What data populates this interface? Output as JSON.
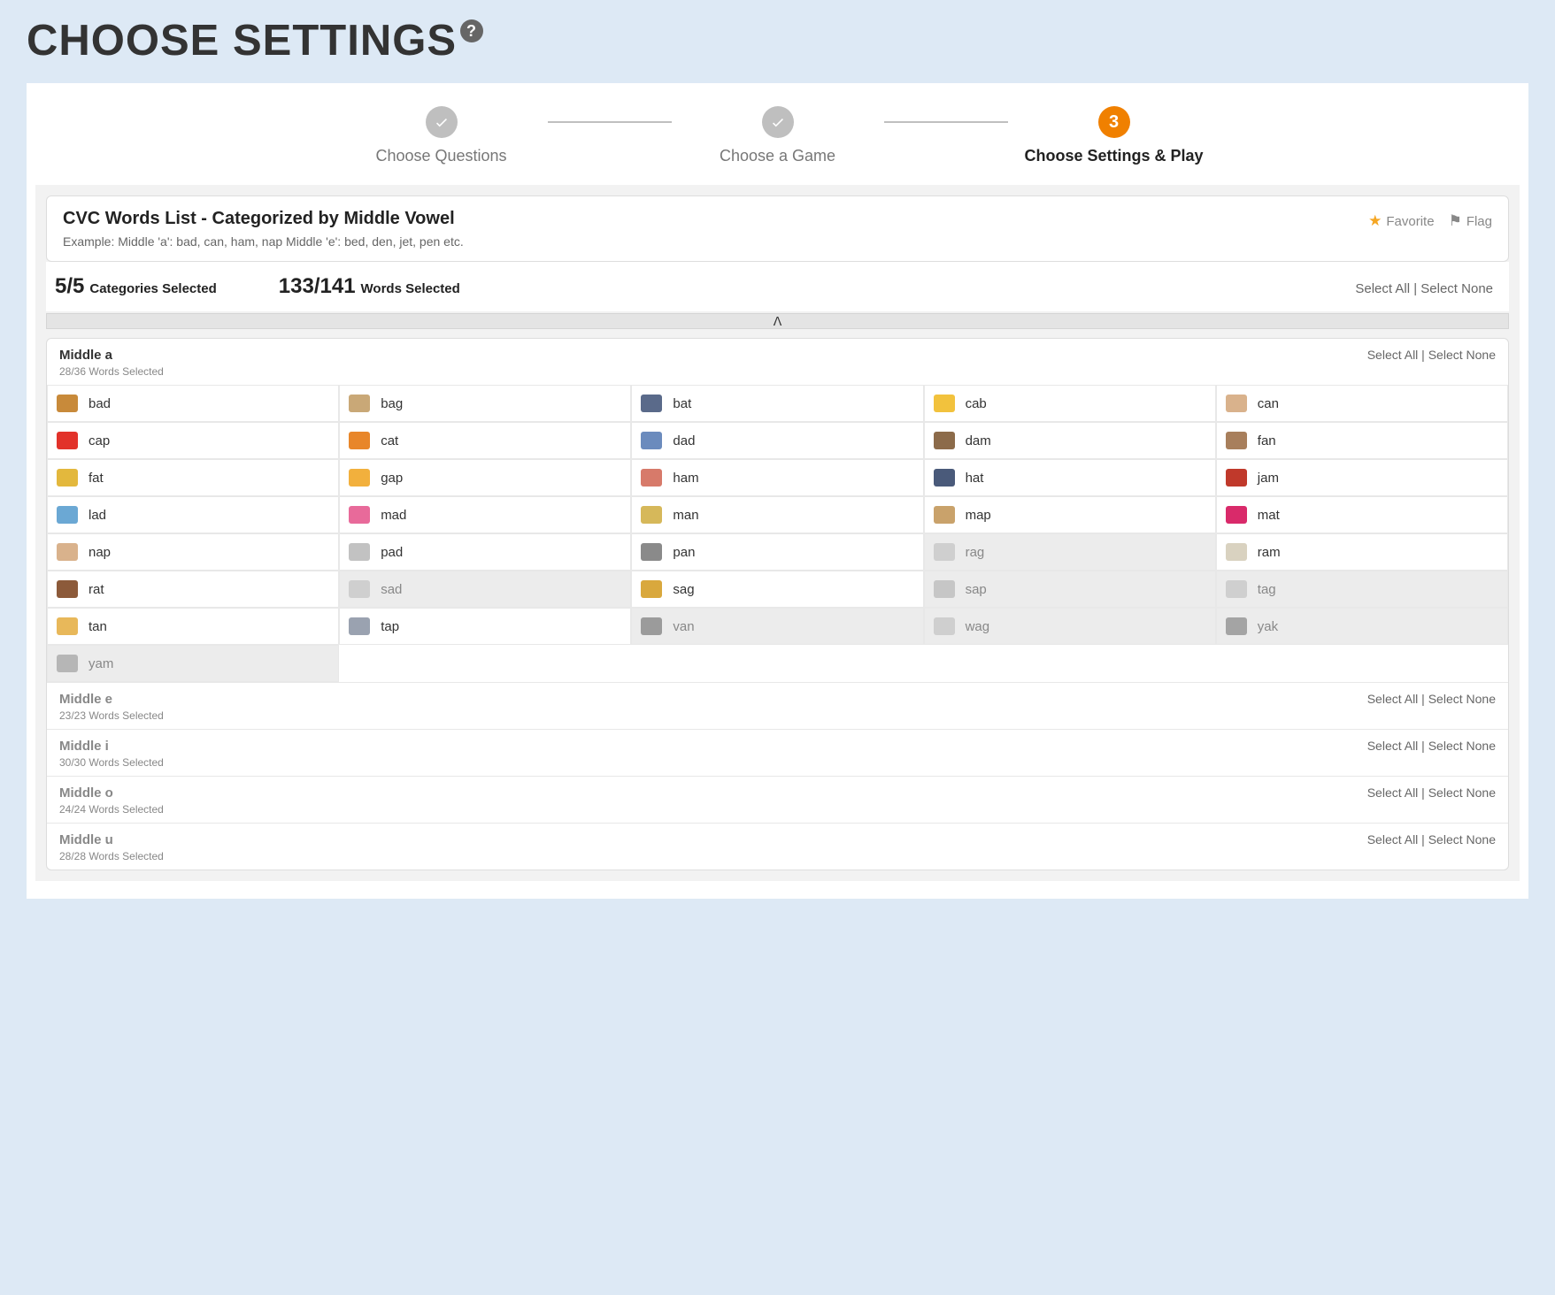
{
  "page_title": "CHOOSE SETTINGS",
  "stepper": {
    "steps": [
      {
        "label": "Choose Questions",
        "state": "done"
      },
      {
        "label": "Choose a Game",
        "state": "done"
      },
      {
        "label": "Choose Settings & Play",
        "state": "active",
        "badge": "3"
      }
    ]
  },
  "list_header": {
    "title": "CVC Words List - Categorized by Middle Vowel",
    "example": "Example: Middle 'a': bad, can, ham, nap Middle 'e': bed, den, jet, pen etc.",
    "favorite_label": "Favorite",
    "flag_label": "Flag"
  },
  "stats": {
    "categories_value": "5/5",
    "categories_label": "Categories Selected",
    "words_value": "133/141",
    "words_label": "Words Selected"
  },
  "select_all_label": "Select All",
  "select_none_label": "Select None",
  "separator": " | ",
  "categories": [
    {
      "name": "Middle a",
      "subtitle": "28/36 Words Selected",
      "expanded": true,
      "words": [
        {
          "w": "bad",
          "s": true,
          "c": "#c88a3a"
        },
        {
          "w": "bag",
          "s": true,
          "c": "#c9a877"
        },
        {
          "w": "bat",
          "s": true,
          "c": "#5a6a8a"
        },
        {
          "w": "cab",
          "s": true,
          "c": "#f2c23d"
        },
        {
          "w": "can",
          "s": true,
          "c": "#d9b28c"
        },
        {
          "w": "cap",
          "s": true,
          "c": "#e2322a"
        },
        {
          "w": "cat",
          "s": true,
          "c": "#e8862a"
        },
        {
          "w": "dad",
          "s": true,
          "c": "#6b8bbd"
        },
        {
          "w": "dam",
          "s": true,
          "c": "#8c6b4a"
        },
        {
          "w": "fan",
          "s": true,
          "c": "#a87f5c"
        },
        {
          "w": "fat",
          "s": true,
          "c": "#e3b83d"
        },
        {
          "w": "gap",
          "s": true,
          "c": "#f2b03d"
        },
        {
          "w": "ham",
          "s": true,
          "c": "#d77a6a"
        },
        {
          "w": "hat",
          "s": true,
          "c": "#4a5a7a"
        },
        {
          "w": "jam",
          "s": true,
          "c": "#c0392b"
        },
        {
          "w": "lad",
          "s": true,
          "c": "#6ba8d4"
        },
        {
          "w": "mad",
          "s": true,
          "c": "#e86a9a"
        },
        {
          "w": "man",
          "s": true,
          "c": "#d6b85a"
        },
        {
          "w": "map",
          "s": true,
          "c": "#c9a26b"
        },
        {
          "w": "mat",
          "s": true,
          "c": "#d92a6a"
        },
        {
          "w": "nap",
          "s": true,
          "c": "#d9b28c"
        },
        {
          "w": "pad",
          "s": true,
          "c": "#c2c2c2"
        },
        {
          "w": "pan",
          "s": true,
          "c": "#8a8a8a"
        },
        {
          "w": "rag",
          "s": false,
          "c": "#b8b8b8"
        },
        {
          "w": "ram",
          "s": true,
          "c": "#d9d2c0"
        },
        {
          "w": "rat",
          "s": true,
          "c": "#8c5a3a"
        },
        {
          "w": "sad",
          "s": false,
          "c": "#b8b8b8"
        },
        {
          "w": "sag",
          "s": true,
          "c": "#d9a83d"
        },
        {
          "w": "sap",
          "s": false,
          "c": "#a8a8a8"
        },
        {
          "w": "tag",
          "s": false,
          "c": "#b8b8b8"
        },
        {
          "w": "tan",
          "s": true,
          "c": "#e8b85a"
        },
        {
          "w": "tap",
          "s": true,
          "c": "#9aa2b0"
        },
        {
          "w": "van",
          "s": false,
          "c": "#5a5a5a"
        },
        {
          "w": "wag",
          "s": false,
          "c": "#b8b8b8"
        },
        {
          "w": "yak",
          "s": false,
          "c": "#6a6a6a"
        },
        {
          "w": "yam",
          "s": false,
          "c": "#8a8a8a"
        }
      ]
    },
    {
      "name": "Middle e",
      "subtitle": "23/23 Words Selected",
      "expanded": false
    },
    {
      "name": "Middle i",
      "subtitle": "30/30 Words Selected",
      "expanded": false
    },
    {
      "name": "Middle o",
      "subtitle": "24/24 Words Selected",
      "expanded": false
    },
    {
      "name": "Middle u",
      "subtitle": "28/28 Words Selected",
      "expanded": false
    }
  ]
}
